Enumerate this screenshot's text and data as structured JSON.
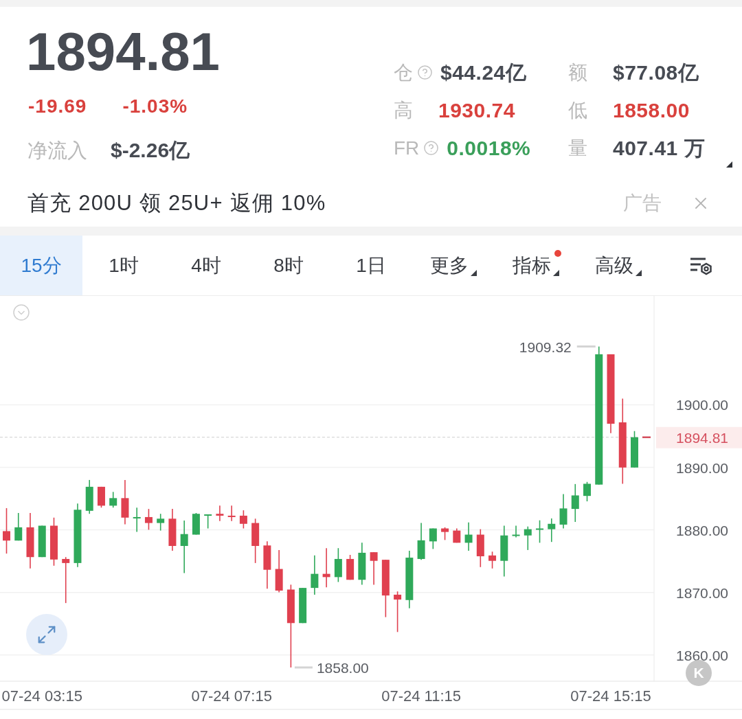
{
  "quote": {
    "price": "1894.81",
    "change": "-19.69",
    "change_pct": "-1.03%",
    "net_inflow": {
      "label": "净流入",
      "value": "$-2.26亿"
    }
  },
  "stats": [
    {
      "label": "仓",
      "help": true,
      "value": "$44.24亿",
      "color": "#474b53"
    },
    {
      "label": "额",
      "help": false,
      "value": "$77.08亿",
      "color": "#474b53"
    },
    {
      "label": "高",
      "help": false,
      "value": "1930.74",
      "color": "#d9413d"
    },
    {
      "label": "低",
      "help": false,
      "value": "1858.00",
      "color": "#d9413d"
    },
    {
      "label": "FR",
      "help": true,
      "value": "0.0018%",
      "color": "#3a9f5a"
    },
    {
      "label": "量",
      "help": false,
      "value": "407.41 万",
      "color": "#474b53"
    }
  ],
  "ad": {
    "text": "首充 200U 领 25U+ 返佣 10%",
    "tag": "广告"
  },
  "tabs": [
    {
      "label": "15分",
      "selected": true,
      "menu": false,
      "dot": false
    },
    {
      "label": "1时",
      "selected": false,
      "menu": false,
      "dot": false
    },
    {
      "label": "4时",
      "selected": false,
      "menu": false,
      "dot": false
    },
    {
      "label": "8时",
      "selected": false,
      "menu": false,
      "dot": false
    },
    {
      "label": "1日",
      "selected": false,
      "menu": false,
      "dot": false
    },
    {
      "label": "更多",
      "selected": false,
      "menu": true,
      "dot": false
    },
    {
      "label": "指标",
      "selected": false,
      "menu": true,
      "dot": true
    },
    {
      "label": "高级",
      "selected": false,
      "menu": true,
      "dot": false
    }
  ],
  "chart": {
    "chart_data": {
      "type": "candlestick",
      "categories": [
        null,
        null,
        null,
        "07-24 03:15",
        null,
        null,
        null,
        null,
        null,
        null,
        null,
        null,
        null,
        null,
        null,
        null,
        null,
        null,
        null,
        "07-24 07:15",
        null,
        null,
        null,
        null,
        null,
        null,
        null,
        null,
        null,
        null,
        null,
        null,
        null,
        null,
        null,
        "07-24 11:15",
        null,
        null,
        null,
        null,
        null,
        null,
        null,
        null,
        null,
        null,
        null,
        null,
        null,
        null,
        null,
        "07-24 15:15",
        null,
        null
      ],
      "ohlc": [
        [
          1879.8,
          1883.48,
          1876.21,
          1878.29
        ],
        [
          1878.29,
          1882.7,
          1878.29,
          1880.41
        ],
        [
          1880.41,
          1882.7,
          1873.83,
          1875.65
        ],
        [
          1875.65,
          1880.67,
          1875.65,
          1880.67
        ],
        [
          1880.67,
          1881.96,
          1874.27,
          1875.26
        ],
        [
          1875.35,
          1875.65,
          1868.3,
          1874.7
        ],
        [
          1874.7,
          1884.21,
          1874.05,
          1883.22
        ],
        [
          1883.05,
          1887.98,
          1882.57,
          1886.89
        ],
        [
          1886.89,
          1886.89,
          1883.56,
          1883.87
        ],
        [
          1883.87,
          1886.07,
          1883.56,
          1885.08
        ],
        [
          1885.08,
          1887.98,
          1880.88,
          1881.96
        ],
        [
          1881.92,
          1883.56,
          1879.67,
          1882.05
        ],
        [
          1882.05,
          1883.35,
          1880.02,
          1881.1
        ],
        [
          1881.1,
          1882.57,
          1879.89,
          1881.79
        ],
        [
          1881.79,
          1883.35,
          1876.65,
          1877.43
        ],
        [
          1877.43,
          1881.49,
          1873.1,
          1879.33
        ],
        [
          1879.24,
          1882.7,
          1879.24,
          1882.57
        ],
        [
          1882.35,
          1882.48,
          1880.23,
          1882.48
        ],
        [
          1882.57,
          1883.87,
          1881.4,
          1882.27
        ],
        [
          1882.27,
          1883.87,
          1881.4,
          1882.05
        ],
        [
          1882.27,
          1883.13,
          1880.23,
          1880.97
        ],
        [
          1881.1,
          1881.79,
          1874.7,
          1877.43
        ],
        [
          1877.51,
          1878.16,
          1870.59,
          1873.62
        ],
        [
          1873.75,
          1876.78,
          1870.03,
          1870.29
        ],
        [
          1870.46,
          1871.24,
          1858.0,
          1865.1
        ],
        [
          1865.1,
          1870.72,
          1865.1,
          1870.72
        ],
        [
          1870.72,
          1875.91,
          1869.64,
          1872.97
        ],
        [
          1872.97,
          1877.08,
          1870.81,
          1872.45
        ],
        [
          1872.45,
          1877.08,
          1871.67,
          1875.35
        ],
        [
          1875.35,
          1876.0,
          1872.02,
          1872.02
        ],
        [
          1872.02,
          1877.94,
          1871.24,
          1876.34
        ],
        [
          1876.43,
          1876.43,
          1871.24,
          1875.05
        ],
        [
          1875.22,
          1875.22,
          1866.05,
          1869.51
        ],
        [
          1869.64,
          1870.16,
          1863.67,
          1868.86
        ],
        [
          1868.78,
          1876.65,
          1867.48,
          1875.56
        ],
        [
          1875.35,
          1881.1,
          1875.22,
          1878.33
        ],
        [
          1878.16,
          1880.23,
          1876.95,
          1880.23
        ],
        [
          1880.23,
          1880.41,
          1878.38,
          1879.67
        ],
        [
          1879.89,
          1880.23,
          1877.94,
          1877.94
        ],
        [
          1877.94,
          1881.19,
          1876.65,
          1879.24
        ],
        [
          1879.24,
          1880.11,
          1874.05,
          1875.78
        ],
        [
          1875.91,
          1876.52,
          1873.83,
          1875.05
        ],
        [
          1875.05,
          1880.67,
          1872.54,
          1879.11
        ],
        [
          1879.02,
          1880.67,
          1878.81,
          1879.24
        ],
        [
          1879.11,
          1880.54,
          1876.78,
          1880.11
        ],
        [
          1880.06,
          1881.53,
          1877.94,
          1880.23
        ],
        [
          1880.11,
          1881.83,
          1878.07,
          1880.97
        ],
        [
          1880.84,
          1885.73,
          1880.23,
          1883.43
        ],
        [
          1883.35,
          1887.33,
          1881.27,
          1885.51
        ],
        [
          1885.43,
          1887.67,
          1884.56,
          1887.37
        ],
        [
          1887.24,
          1909.32,
          1887.24,
          1908.08
        ],
        [
          1908.08,
          1908.08,
          1895.46,
          1896.97
        ],
        [
          1897.19,
          1900.99,
          1887.37,
          1889.97
        ],
        [
          1889.97,
          1895.8,
          1889.97,
          1894.81
        ]
      ],
      "ylim": [
        1855.8,
        1917.4
      ],
      "grid": true,
      "yticks": [
        {
          "value": 1900,
          "label": "1900.00"
        },
        {
          "value": 1890,
          "label": "1890.00"
        },
        {
          "value": 1880,
          "label": "1880.00"
        },
        {
          "value": 1870,
          "label": "1870.00"
        },
        {
          "value": 1860,
          "label": "1860.00"
        }
      ],
      "ref_lines": [
        {
          "axis": "y",
          "value": 1894.81,
          "label": "1894.81"
        }
      ],
      "annotations": [
        "1909.32",
        "1858.00"
      ]
    },
    "k_button": "K"
  }
}
